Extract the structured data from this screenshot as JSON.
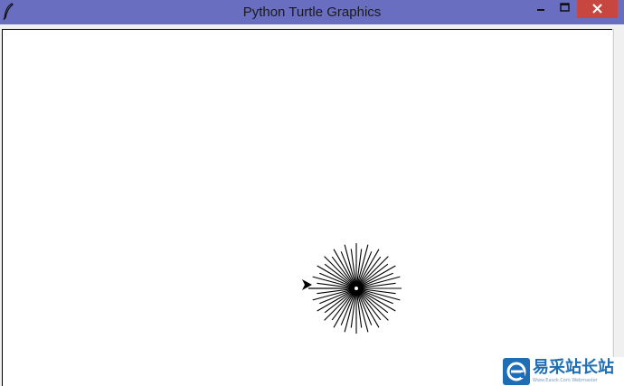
{
  "window": {
    "title": "Python Turtle Graphics",
    "icon": "feather-icon"
  },
  "controls": {
    "minimize_icon": "minimize-icon",
    "maximize_icon": "maximize-icon",
    "close_icon": "close-icon"
  },
  "colors": {
    "titlebar": "#6a6ec0",
    "close_button": "#c7463f",
    "pen": "#000000",
    "canvas": "#ffffff",
    "watermark_blue": "#1f6eb5"
  },
  "watermark": {
    "text": "易采站长站",
    "subtext": "Www.Easck.Com  Webmaster",
    "logo_icon": "e-logo-icon"
  },
  "turtle": {
    "icon": "turtle-arrow-icon",
    "heading": "east"
  },
  "drawing": {
    "pattern": "radial-starburst",
    "line_count": 48,
    "color": "#000000"
  }
}
